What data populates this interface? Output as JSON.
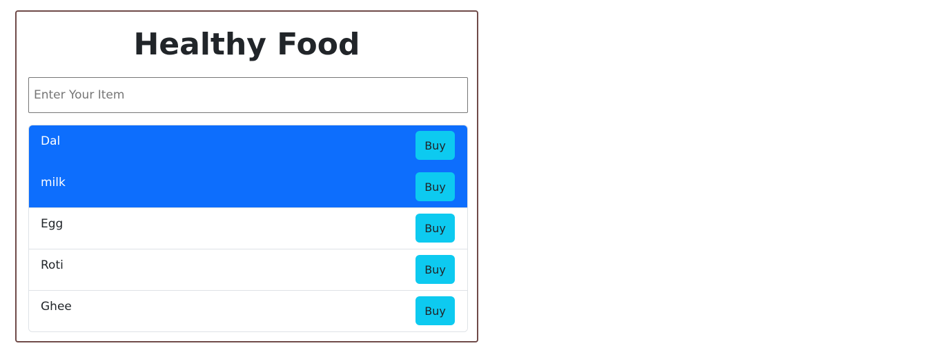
{
  "header": {
    "title": "Healthy Food"
  },
  "search": {
    "placeholder": "Enter Your Item",
    "value": ""
  },
  "items": [
    {
      "name": "Dal",
      "active": true,
      "button_label": "Buy"
    },
    {
      "name": "milk",
      "active": true,
      "button_label": "Buy"
    },
    {
      "name": "Egg",
      "active": false,
      "button_label": "Buy"
    },
    {
      "name": "Roti",
      "active": false,
      "button_label": "Buy"
    },
    {
      "name": "Ghee",
      "active": false,
      "button_label": "Buy"
    }
  ],
  "colors": {
    "active_bg": "#0d6efd",
    "button_bg": "#0dcaf0",
    "card_border": "#6f4a48"
  }
}
